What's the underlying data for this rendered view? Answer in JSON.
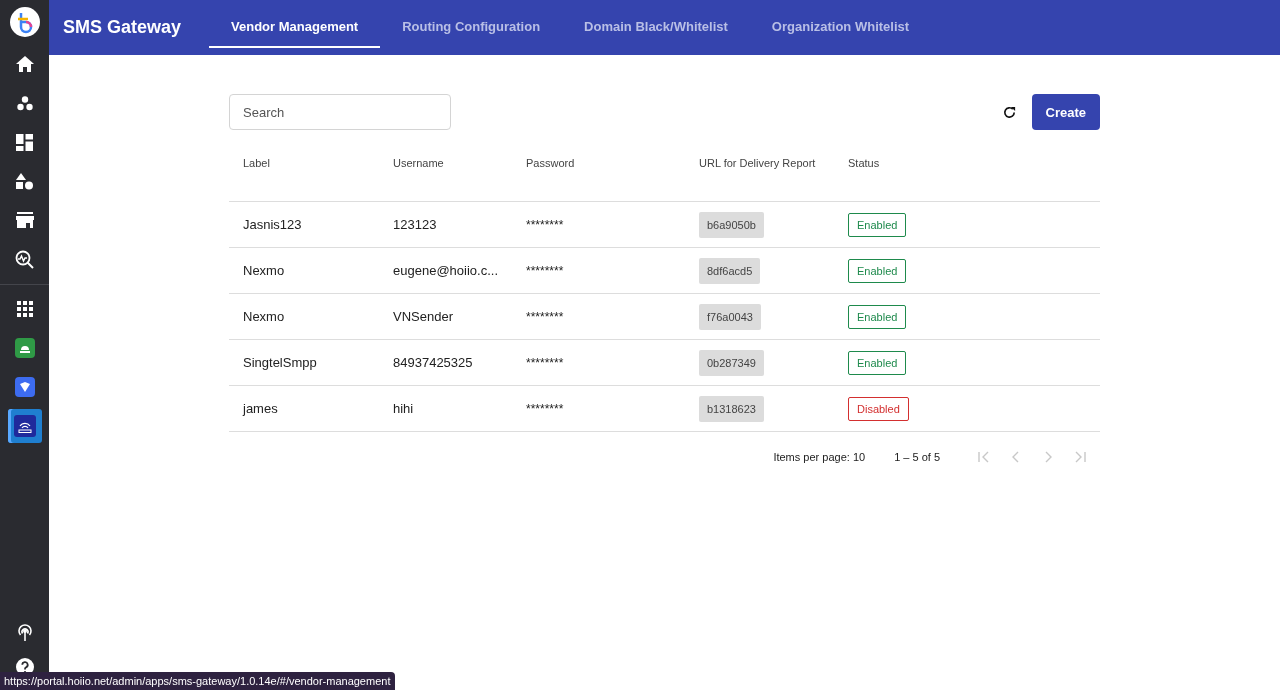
{
  "sidebar": {
    "items": [
      {
        "kind": "logo",
        "selected": false
      },
      {
        "kind": "home",
        "selected": false
      },
      {
        "kind": "dots",
        "selected": false
      },
      {
        "kind": "dashboard",
        "selected": false
      },
      {
        "kind": "shapes",
        "selected": false
      },
      {
        "kind": "store",
        "selected": false
      },
      {
        "kind": "monitor",
        "selected": false
      }
    ],
    "app_items": [
      {
        "kind": "grid",
        "selected": false
      },
      {
        "kind": "app-green",
        "selected": false
      },
      {
        "kind": "app-blue",
        "selected": false
      },
      {
        "kind": "app-router",
        "selected": true
      }
    ],
    "bottom_items": [
      {
        "kind": "antenna"
      },
      {
        "kind": "help"
      }
    ]
  },
  "header": {
    "title": "SMS Gateway",
    "tabs": [
      {
        "label": "Vendor Management",
        "selected": true
      },
      {
        "label": "Routing Configuration",
        "selected": false
      },
      {
        "label": "Domain Black/Whitelist",
        "selected": false
      },
      {
        "label": "Organization Whitelist",
        "selected": false
      }
    ]
  },
  "toolbar": {
    "search": {
      "placeholder": "Search"
    },
    "create_button": "Create"
  },
  "table": {
    "columns": [
      "Label",
      "Username",
      "Password",
      "URL for Delivery Report",
      "Status"
    ],
    "rows": [
      {
        "label": "Jasnis123",
        "username": "123123",
        "password": "********",
        "url": "b6a9050b",
        "status": {
          "label": "Enabled",
          "kind": "enabled"
        }
      },
      {
        "label": "Nexmo",
        "username": "eugene@hoiio.c...",
        "password": "********",
        "url": "8df6acd5",
        "status": {
          "label": "Enabled",
          "kind": "enabled"
        }
      },
      {
        "label": "Nexmo",
        "username": "VNSender",
        "password": "********",
        "url": "f76a0043",
        "status": {
          "label": "Enabled",
          "kind": "enabled"
        }
      },
      {
        "label": "SingtelSmpp",
        "username": "84937425325",
        "password": "********",
        "url": "0b287349",
        "status": {
          "label": "Enabled",
          "kind": "enabled"
        }
      },
      {
        "label": "james",
        "username": "hihi",
        "password": "********",
        "url": "b1318623",
        "status": {
          "label": "Disabled",
          "kind": "disabled"
        }
      }
    ]
  },
  "pagination": {
    "items_per_page": "Items per page: 10",
    "range": "1 – 5 of 5",
    "buttons": [
      {
        "kind": "first",
        "disabled": true
      },
      {
        "kind": "prev",
        "disabled": true
      },
      {
        "kind": "next",
        "disabled": true
      },
      {
        "kind": "last",
        "disabled": true
      }
    ]
  },
  "status_url": "https://portal.hoiio.net/admin/apps/sms-gateway/1.0.14e/#/vendor-management"
}
